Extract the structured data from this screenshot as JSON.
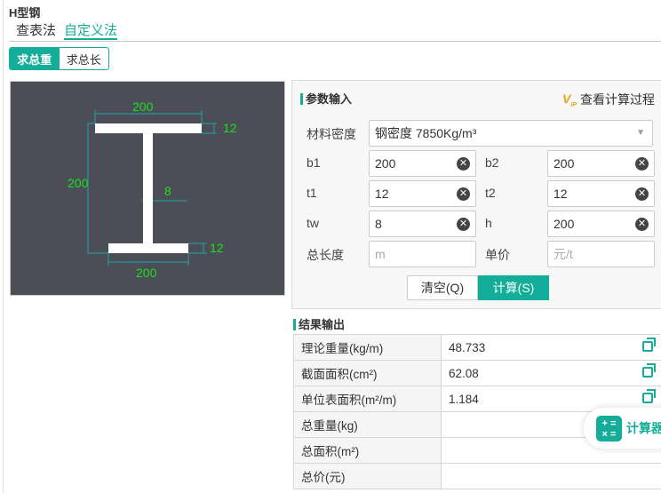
{
  "title": "H型钢",
  "tabs": [
    {
      "label": "查表法"
    },
    {
      "label": "自定义法",
      "active": true
    }
  ],
  "mode": [
    {
      "label": "求总重",
      "active": true
    },
    {
      "label": "求总长"
    }
  ],
  "accent": "#13ad99",
  "diagram": {
    "b1": "200",
    "t1": "12",
    "h": "200",
    "tw": "8",
    "t2": "12",
    "b2": "200"
  },
  "params": {
    "heading": "参数输入",
    "vip_link": "查看计算过程",
    "density_label": "材料密度",
    "density_value": "钢密度 7850Kg/m³",
    "b1_label": "b1",
    "b1": "200",
    "b2_label": "b2",
    "b2": "200",
    "t1_label": "t1",
    "t1": "12",
    "t2_label": "t2",
    "t2": "12",
    "tw_label": "tw",
    "tw": "8",
    "h_label": "h",
    "h": "200",
    "length_label": "总长度",
    "length_placeholder": "m",
    "price_label": "单价",
    "price_placeholder": "元/t",
    "clear": "清空(Q)",
    "calc": "计算(S)"
  },
  "results": {
    "heading": "结果输出",
    "rows": [
      {
        "label": "理论重量(kg/m)",
        "value": "48.733"
      },
      {
        "label": "截面面积(cm²)",
        "value": "62.08"
      },
      {
        "label": "单位表面积(m²/m)",
        "value": "1.184"
      },
      {
        "label": "总重量(kg)",
        "value": ""
      },
      {
        "label": "总面积(m²)",
        "value": ""
      },
      {
        "label": "总价(元)",
        "value": ""
      }
    ]
  },
  "calculator": "计算器"
}
